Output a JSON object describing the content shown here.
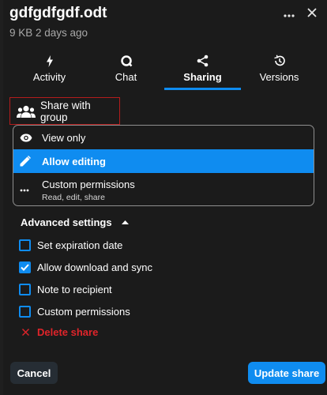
{
  "header": {
    "title": "gdfgdfgdf.odt",
    "subtitle": "9 KB 2 days ago",
    "more_icon": "more-horizontal-icon",
    "close_icon": "close-icon"
  },
  "tabs": [
    {
      "label": "Activity",
      "icon": "lightning-icon",
      "active": false
    },
    {
      "label": "Chat",
      "icon": "chat-icon",
      "active": false
    },
    {
      "label": "Sharing",
      "icon": "share-icon",
      "active": true
    },
    {
      "label": "Versions",
      "icon": "history-icon",
      "active": false
    }
  ],
  "share_group": {
    "label": "Share with group",
    "icon": "group-icon"
  },
  "permissions": {
    "options": [
      {
        "label": "View only",
        "icon": "eye-icon"
      },
      {
        "label": "Allow editing",
        "icon": "pencil-icon"
      },
      {
        "label": "Custom permissions",
        "description": "Read, edit, share",
        "icon": "more-horizontal-icon"
      }
    ],
    "selected": "Allow editing"
  },
  "advanced": {
    "label": "Advanced settings",
    "options": [
      {
        "label": "Set expiration date",
        "checked": false
      },
      {
        "label": "Allow download and sync",
        "checked": true
      },
      {
        "label": "Note to recipient",
        "checked": false
      },
      {
        "label": "Custom permissions",
        "checked": false
      }
    ],
    "delete_label": "Delete share"
  },
  "footer": {
    "cancel_label": "Cancel",
    "update_label": "Update share"
  },
  "colors": {
    "accent": "#0f8cf0",
    "danger": "#e0242a",
    "background": "#1b1b1b"
  }
}
